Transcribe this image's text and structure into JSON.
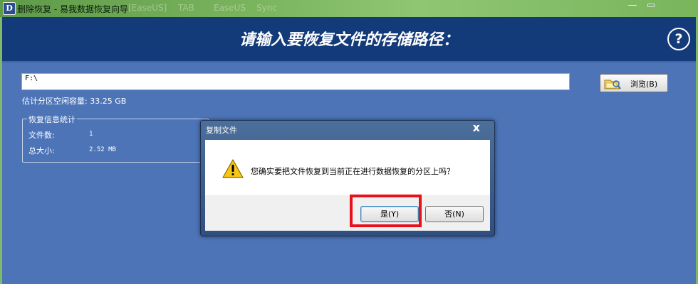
{
  "window": {
    "title": "删除恢复 - 易我数据恢复向导",
    "ghost_tabs": [
      "[EaseUS]",
      "TAB",
      "EaseUS",
      "Sync"
    ],
    "minimize_glyph": "—",
    "maximize_glyph": "▭"
  },
  "header": {
    "title": "请输入要恢复文件的存储路径：",
    "help_glyph": "?"
  },
  "path": {
    "value": "F:\\",
    "browse_label": "浏览(B)",
    "free_space": "估计分区空闲容量: 33.25 GB"
  },
  "stats": {
    "legend": "恢复信息统计",
    "rows": [
      {
        "label": "文件数:",
        "value": "1"
      },
      {
        "label": "总大小:",
        "value": "2.52 MB"
      }
    ]
  },
  "dialog": {
    "title": "复制文件",
    "close_glyph": "x",
    "message": "您确实要把文件恢复到当前正在进行数据恢复的分区上吗？",
    "yes_label": "是(Y)",
    "no_label": "否(N)"
  },
  "colors": {
    "highlight": "#e8101b",
    "header_bg": "#143b79",
    "body_bg": "#4c74b7"
  },
  "icons": {
    "app": "app-logo-icon",
    "browse": "folder-browse-icon",
    "warning": "warning-icon",
    "help": "help-icon"
  }
}
